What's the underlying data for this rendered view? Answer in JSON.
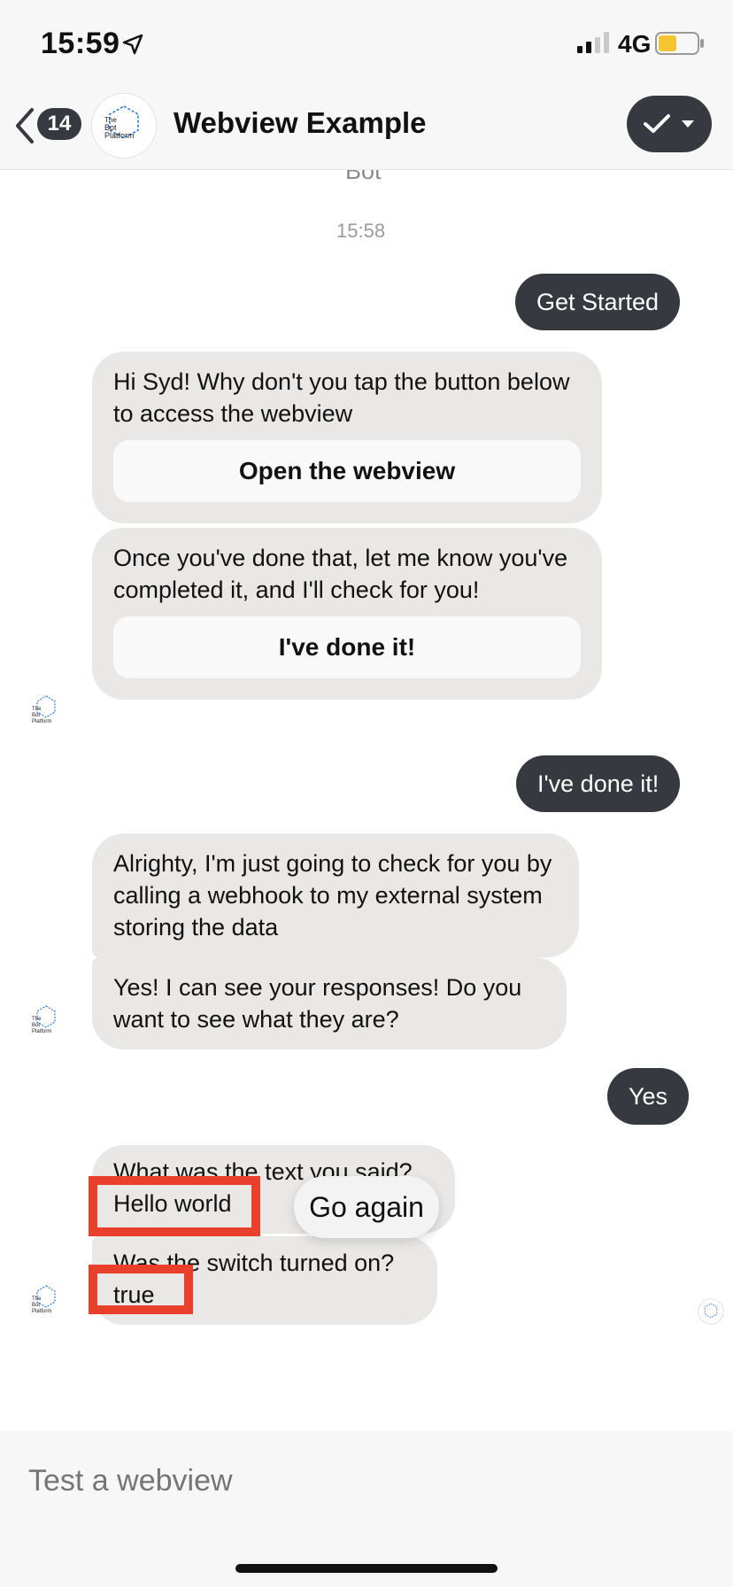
{
  "status_bar": {
    "time": "15:59",
    "network": "4G"
  },
  "header": {
    "back_count": "14",
    "title": "Webview Example",
    "logo_text": "The Bot Platform"
  },
  "chat": {
    "bot_name_partial": "Bot",
    "timestamp": "15:58",
    "messages": [
      {
        "from": "user",
        "text": "Get Started"
      },
      {
        "from": "bot",
        "text": "Hi Syd! Why don't you tap the button below to access the webview",
        "button": "Open the webview"
      },
      {
        "from": "bot",
        "text": "Once you've done that, let me know you've completed it, and I'll check for you!",
        "button": "I've done it!"
      },
      {
        "from": "user",
        "text": "I've done it!"
      },
      {
        "from": "bot",
        "text": "Alrighty, I'm just going to check for you by calling a webhook to my external system storing the data"
      },
      {
        "from": "bot",
        "text": "Yes! I can see your responses! Do you want to see what they are?"
      },
      {
        "from": "user",
        "text": "Yes"
      },
      {
        "from": "bot",
        "line1": "What was the text you said?",
        "line2": "Hello world"
      },
      {
        "from": "bot",
        "line1": "Was the switch turned on?",
        "line2": "true"
      }
    ],
    "quick_reply": "Go again"
  },
  "composer": {
    "placeholder": "Test a webview"
  },
  "colors": {
    "user_bubble": "#36393f",
    "bot_bubble": "#e9e8e7",
    "highlight": "#e8402a"
  }
}
